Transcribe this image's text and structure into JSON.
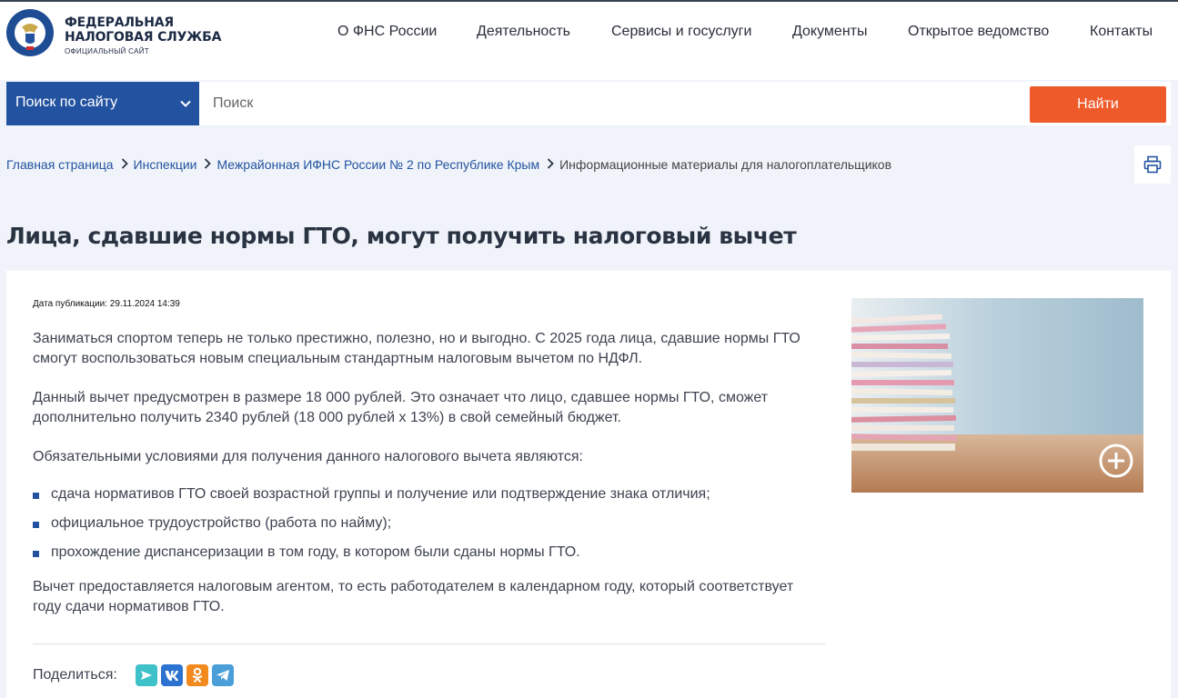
{
  "header": {
    "logo": {
      "line1": "ФЕДЕРАЛЬНАЯ",
      "line2": "НАЛОГОВАЯ СЛУЖБА",
      "line3": "ОФИЦИАЛЬНЫЙ САЙТ"
    },
    "nav": [
      {
        "label": "О ФНС России"
      },
      {
        "label": "Деятельность"
      },
      {
        "label": "Сервисы и госуслуги"
      },
      {
        "label": "Документы"
      },
      {
        "label": "Открытое ведомство"
      },
      {
        "label": "Контакты"
      }
    ]
  },
  "search": {
    "scope_label": "Поиск по сайту",
    "placeholder": "Поиск",
    "button_label": "Найти"
  },
  "breadcrumb": {
    "items": [
      {
        "label": "Главная страница"
      },
      {
        "label": "Инспекции"
      },
      {
        "label": "Межрайонная ИФНС России № 2 по Республике Крым"
      }
    ],
    "current": "Информационные материалы для налогоплательщиков"
  },
  "article": {
    "title": "Лица, сдавшие нормы ГТО, могут получить налоговый вычет",
    "pub_date": "Дата публикации: 29.11.2024 14:39",
    "paragraphs": [
      "Заниматься спортом теперь не только престижно, полезно, но и выгодно. С 2025 года лица, сдавшие нормы ГТО смогут воспользоваться новым специальным стандартным налоговым вычетом по НДФЛ.",
      "Данный вычет предусмотрен в размере 18 000 рублей. Это означает что лицо, сдавшее нормы ГТО, сможет дополнительно получить 2340 рублей (18 000 рублей х 13%) в свой семейный бюджет.",
      "Обязательными условиями для получения данного налогового вычета являются:"
    ],
    "conditions": [
      "сдача нормативов ГТО своей возрастной группы и получение или подтверждение знака отличия;",
      "официальное трудоустройство (работа по найму);",
      "прохождение диспансеризации в том году, в котором были сданы нормы ГТО."
    ],
    "closing": "Вычет предоставляется налоговым агентом, то есть работодателем в календарном году, который соответствует году сдачи нормативов ГТО."
  },
  "share": {
    "label": "Поделиться:",
    "buttons": [
      {
        "icon": "send-icon",
        "color": "#3fc1c9"
      },
      {
        "icon": "vk-icon",
        "color": "#2b72d1"
      },
      {
        "icon": "ok-icon",
        "color": "#f28a1e"
      },
      {
        "icon": "telegram-icon",
        "color": "#4a9fd9"
      }
    ]
  },
  "colors": {
    "brand_blue": "#2353a0",
    "accent_orange": "#ef5a2a",
    "page_bg": "#f0f4fa"
  }
}
